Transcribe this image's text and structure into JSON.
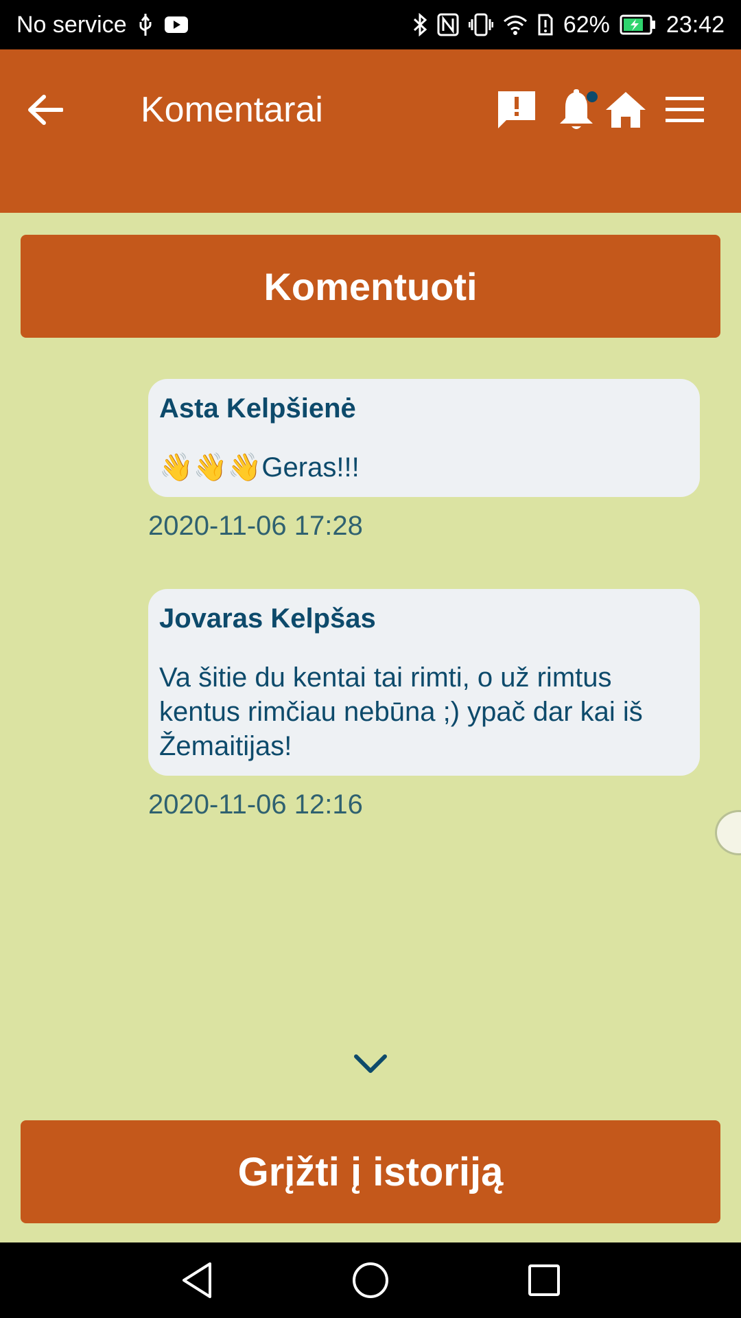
{
  "status_bar": {
    "carrier": "No service",
    "battery": "62%",
    "time": "23:42",
    "icons": [
      "usb-icon",
      "youtube-icon",
      "bluetooth-icon",
      "nfc-icon",
      "vibrate-icon",
      "wifi-icon",
      "battery-alert-icon",
      "battery-icon"
    ]
  },
  "app_bar": {
    "title": "Komentarai",
    "icons": [
      "back-arrow-icon",
      "report-icon",
      "bell-icon",
      "home-icon",
      "menu-icon"
    ],
    "background": "#c4581b"
  },
  "actions": {
    "comment_label": "Komentuoti",
    "return_label": "Grįžti į istoriją"
  },
  "comments": [
    {
      "author": "Asta Kelpšienė",
      "text": "👋👋👋Geras!!!",
      "timestamp": "2020-11-06 17:28"
    },
    {
      "author": "Jovaras Kelpšas",
      "text": "Va šitie du kentai tai rimti, o už rimtus kentus rimčiau nebūna ;) ypač dar kai iš Žemaitijas!",
      "timestamp": "2020-11-06 12:16"
    }
  ],
  "colors": {
    "accent": "#c4581b",
    "page_background": "#dbe3a2",
    "bubble": "#eef1f4",
    "text": "#0d4a6b"
  }
}
